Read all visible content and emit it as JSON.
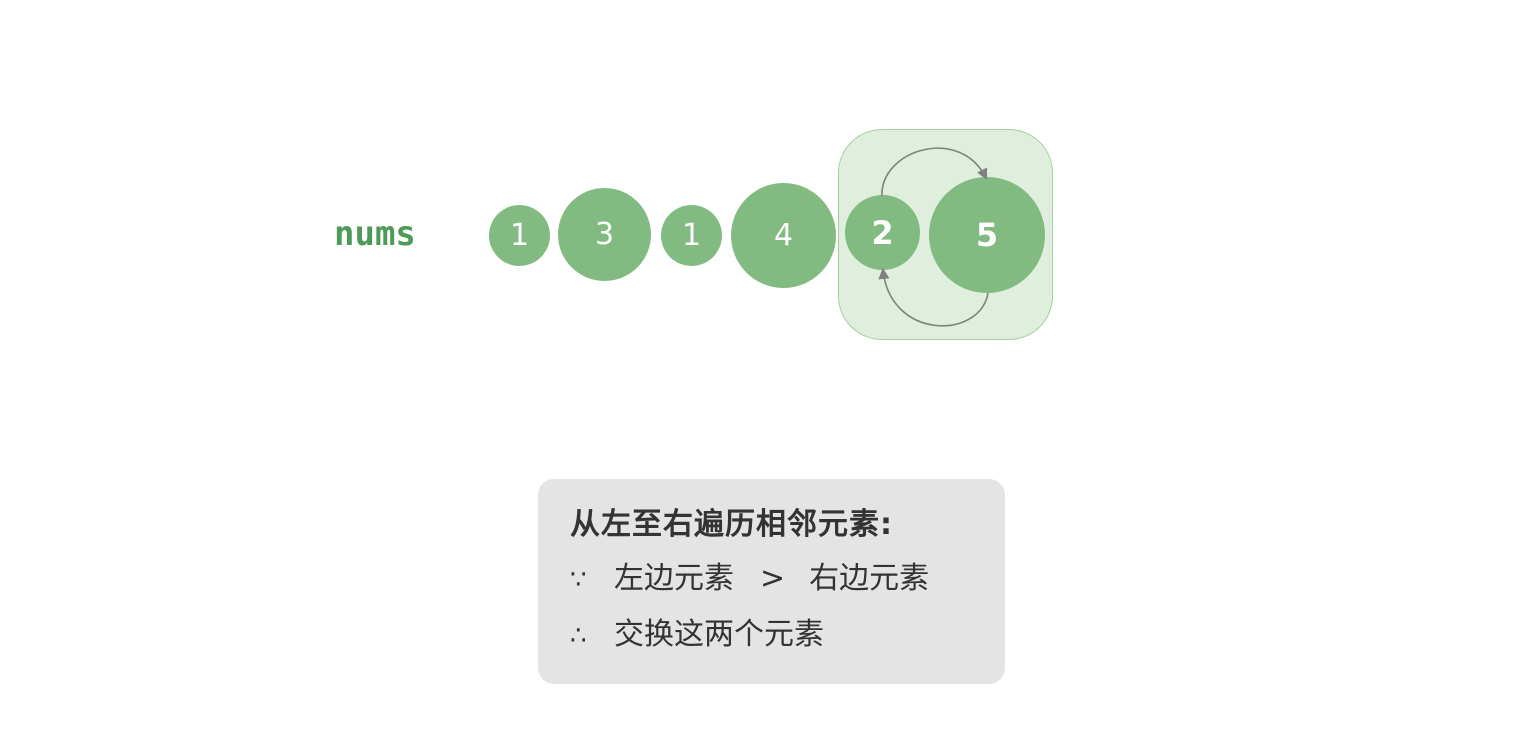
{
  "array": {
    "label": "nums",
    "items": [
      {
        "value": "1"
      },
      {
        "value": "3"
      },
      {
        "value": "1"
      },
      {
        "value": "4"
      },
      {
        "value": "2",
        "compared": true
      },
      {
        "value": "5",
        "compared": true
      }
    ]
  },
  "colors": {
    "ball": "#82bb82",
    "label": "#4e9a57",
    "highlight": "#dfeedd",
    "arrow": "#808080",
    "panel": "#e4e4e4"
  },
  "info": {
    "title": "从左至右遍历相邻元素:",
    "line1_symbol": "∵",
    "line1_left": "左边元素",
    "line1_op": ">",
    "line1_right": "右边元素",
    "line2_symbol": "∴",
    "line2_text": "交换这两个元素"
  }
}
